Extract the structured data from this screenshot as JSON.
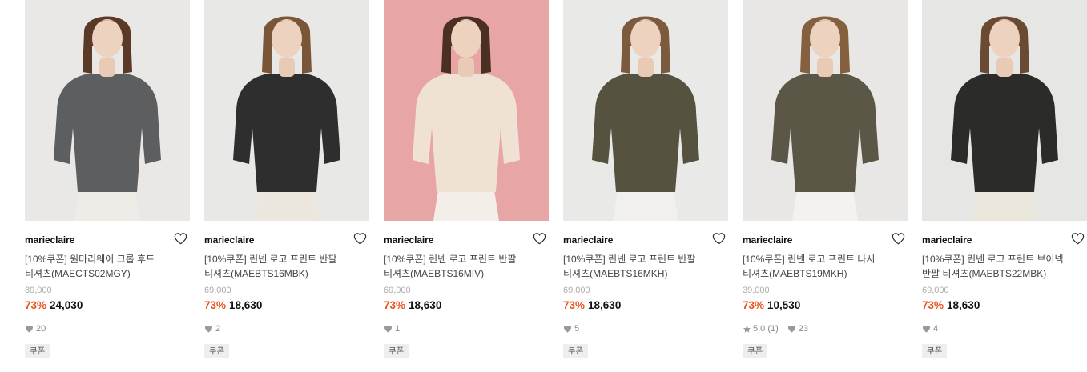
{
  "products": [
    {
      "brand": "marieclaire",
      "title_line1": "[10%쿠폰] 원마리웨어 크롭 후드",
      "title_line2": "티셔츠(MAECTS02MGY)",
      "original_price": "89,000",
      "discount": "73%",
      "sale_price": "24,030",
      "rating": "",
      "likes": "20",
      "coupon": "쿠폰",
      "colors": {
        "bg": "#e9e8e6",
        "garment": "#5c5e5f",
        "bottom": "#efece7",
        "hair": "#5a3a26"
      }
    },
    {
      "brand": "marieclaire",
      "title_line1": "[10%쿠폰] 린넨 로고 프린트 반팔",
      "title_line2": "티셔츠(MAEBTS16MBK)",
      "original_price": "69,000",
      "discount": "73%",
      "sale_price": "18,630",
      "rating": "",
      "likes": "2",
      "coupon": "쿠폰",
      "colors": {
        "bg": "#e8e8e7",
        "garment": "#2e2e2e",
        "bottom": "#ebe7df",
        "hair": "#7a5638"
      }
    },
    {
      "brand": "marieclaire",
      "title_line1": "[10%쿠폰] 린넨 로고 프린트 반팔",
      "title_line2": "티셔츠(MAEBTS16MIV)",
      "original_price": "69,000",
      "discount": "73%",
      "sale_price": "18,630",
      "rating": "",
      "likes": "1",
      "coupon": "쿠폰",
      "colors": {
        "bg": "#e7a5a6",
        "garment": "#efe1d4",
        "bottom": "#f3efe8",
        "hair": "#4a2f22"
      }
    },
    {
      "brand": "marieclaire",
      "title_line1": "[10%쿠폰] 린넨 로고 프린트 반팔",
      "title_line2": "티셔츠(MAEBTS16MKH)",
      "original_price": "69,000",
      "discount": "73%",
      "sale_price": "18,630",
      "rating": "",
      "likes": "5",
      "coupon": "쿠폰",
      "colors": {
        "bg": "#e9e9e8",
        "garment": "#55533f",
        "bottom": "#f2f0ec",
        "hair": "#7b5a3e"
      }
    },
    {
      "brand": "marieclaire",
      "title_line1": "[10%쿠폰] 린넨 로고 프린트 나시",
      "title_line2": "티셔츠(MAEBTS19MKH)",
      "original_price": "39,000",
      "discount": "73%",
      "sale_price": "10,530",
      "rating": "5.0 (1)",
      "likes": "23",
      "coupon": "쿠폰",
      "colors": {
        "bg": "#e8e7e6",
        "garment": "#5b5747",
        "bottom": "#f4f2ee",
        "hair": "#84603f"
      }
    },
    {
      "brand": "marieclaire",
      "title_line1": "[10%쿠폰] 린넨 로고 프린트 브이넥",
      "title_line2": "반팔 티셔츠(MAEBTS22MBK)",
      "original_price": "69,000",
      "discount": "73%",
      "sale_price": "18,630",
      "rating": "",
      "likes": "4",
      "coupon": "쿠폰",
      "colors": {
        "bg": "#e6e6e5",
        "garment": "#2b2b2a",
        "bottom": "#ebe6dc",
        "hair": "#6a4a32"
      }
    }
  ]
}
